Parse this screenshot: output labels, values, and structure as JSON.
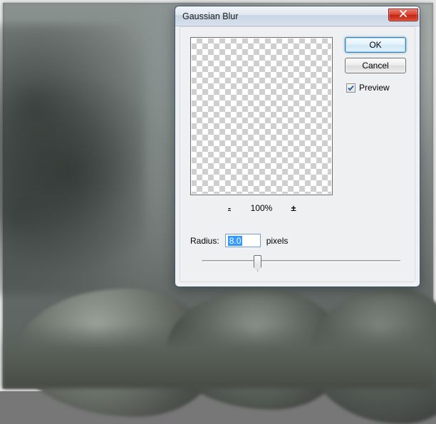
{
  "dialog": {
    "title": "Gaussian Blur",
    "close_icon": "x",
    "buttons": {
      "ok": "OK",
      "cancel": "Cancel"
    },
    "preview": {
      "checked": true,
      "label": "Preview"
    },
    "zoom": {
      "minus": "-",
      "percent": "100%",
      "plus": "+"
    },
    "radius": {
      "label": "Radius:",
      "value": "8.0",
      "unit": "pixels"
    }
  }
}
